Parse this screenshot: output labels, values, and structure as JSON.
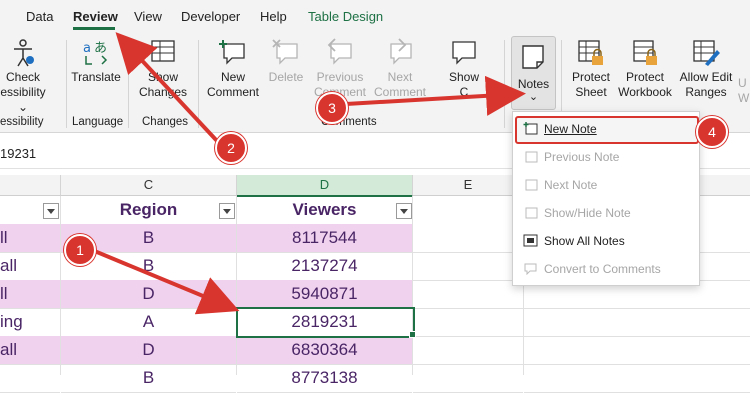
{
  "ribbon_tabs": [
    "Data",
    "Review",
    "View",
    "Developer",
    "Help",
    "Table Design"
  ],
  "groups": {
    "accessibility": {
      "button_line1": "Check",
      "button_line2": "essibility",
      "label": "essibility"
    },
    "language": {
      "button": "Translate",
      "label": "Language"
    },
    "changes": {
      "button_line1": "Show",
      "button_line2": "Changes",
      "label": "Changes"
    },
    "comments": {
      "new_line1": "New",
      "new_line2": "Comment",
      "delete": "Delete",
      "previous_line1": "Previous",
      "previous_line2": "Comment",
      "next_line1": "Next",
      "next_line2": "Comment",
      "show_line1": "Show",
      "show_line2": "C",
      "label": "Comments"
    },
    "notes": {
      "button": "Notes",
      "caret": "⌄"
    },
    "protect": {
      "sheet_line1": "Protect",
      "sheet_line2": "Sheet",
      "workbook_line1": "Protect",
      "workbook_line2": "Workbook",
      "allow_line1": "Allow Edit",
      "allow_line2": "Ranges",
      "extra_line1": "U",
      "extra_line2": "W"
    }
  },
  "name_box": "19231",
  "columns": [
    "C",
    "D",
    "E"
  ],
  "table": {
    "headers": [
      "Region",
      "Viewers"
    ],
    "rows": [
      {
        "b": "ll",
        "c": "B",
        "d": "8117544"
      },
      {
        "b": "all",
        "c": "B",
        "d": "2137274"
      },
      {
        "b": "ll",
        "c": "D",
        "d": "5940871"
      },
      {
        "b": "ing",
        "c": "A",
        "d": "2819231"
      },
      {
        "b": "all",
        "c": "D",
        "d": "6830364"
      },
      {
        "b": "",
        "c": "B",
        "d": "8773138"
      }
    ]
  },
  "notes_menu": {
    "items": [
      "New Note",
      "Previous Note",
      "Next Note",
      "Show/Hide Note",
      "Show All Notes",
      "Convert to Comments"
    ],
    "enabled": [
      true,
      false,
      false,
      false,
      true,
      false
    ]
  },
  "callouts": [
    "1",
    "2",
    "3",
    "4"
  ],
  "colors": {
    "accent_green": "#1e7145",
    "callout_red": "#d9352f",
    "band_pink": "#f0d2ee",
    "text_purple": "#4a2566"
  }
}
